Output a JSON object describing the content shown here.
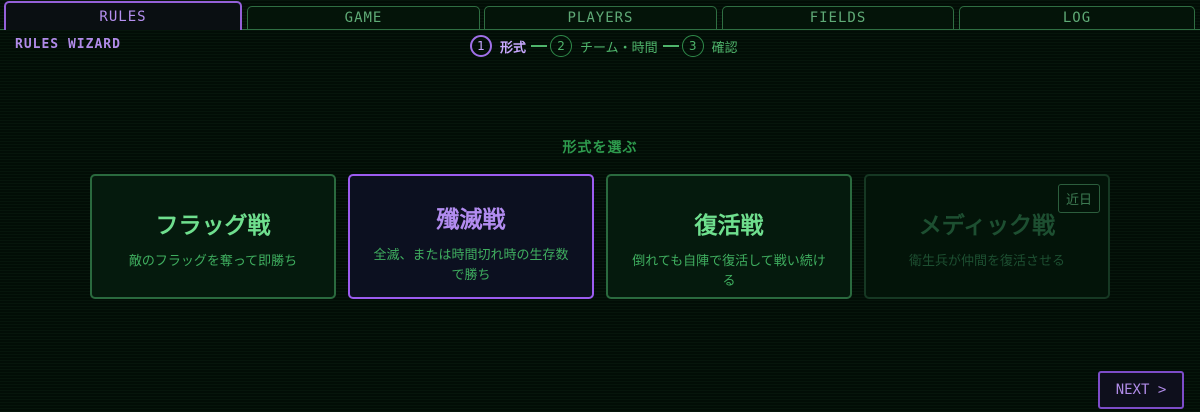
{
  "tabs": [
    {
      "label": "RULES",
      "active": true
    },
    {
      "label": "GAME"
    },
    {
      "label": "PLAYERS"
    },
    {
      "label": "FIELDS"
    },
    {
      "label": "LOG"
    }
  ],
  "wizard": {
    "title": "RULES WIZARD",
    "steps": [
      {
        "number": "1",
        "label": "形式",
        "active": true
      },
      {
        "number": "2",
        "label": "チーム・時間"
      },
      {
        "number": "3",
        "label": "確認"
      }
    ]
  },
  "main": {
    "section_title": "形式を選ぶ",
    "cards": [
      {
        "title": "フラッグ戦",
        "description": "敵のフラッグを奪って即勝ち"
      },
      {
        "title": "殲滅戦",
        "description": "全滅、または時間切れ時の生存数で勝ち",
        "selected": true
      },
      {
        "title": "復活戦",
        "description": "倒れても自陣で復活して戦い続ける"
      },
      {
        "title": "メディック戦",
        "description": "衛生兵が仲間を復活させる",
        "disabled": true,
        "badge": "近日"
      }
    ]
  },
  "footer": {
    "next_label": "NEXT >"
  },
  "colors": {
    "accent_purple": "#9c5cf0",
    "accent_green": "#4fb46b",
    "background": "#020d06"
  }
}
